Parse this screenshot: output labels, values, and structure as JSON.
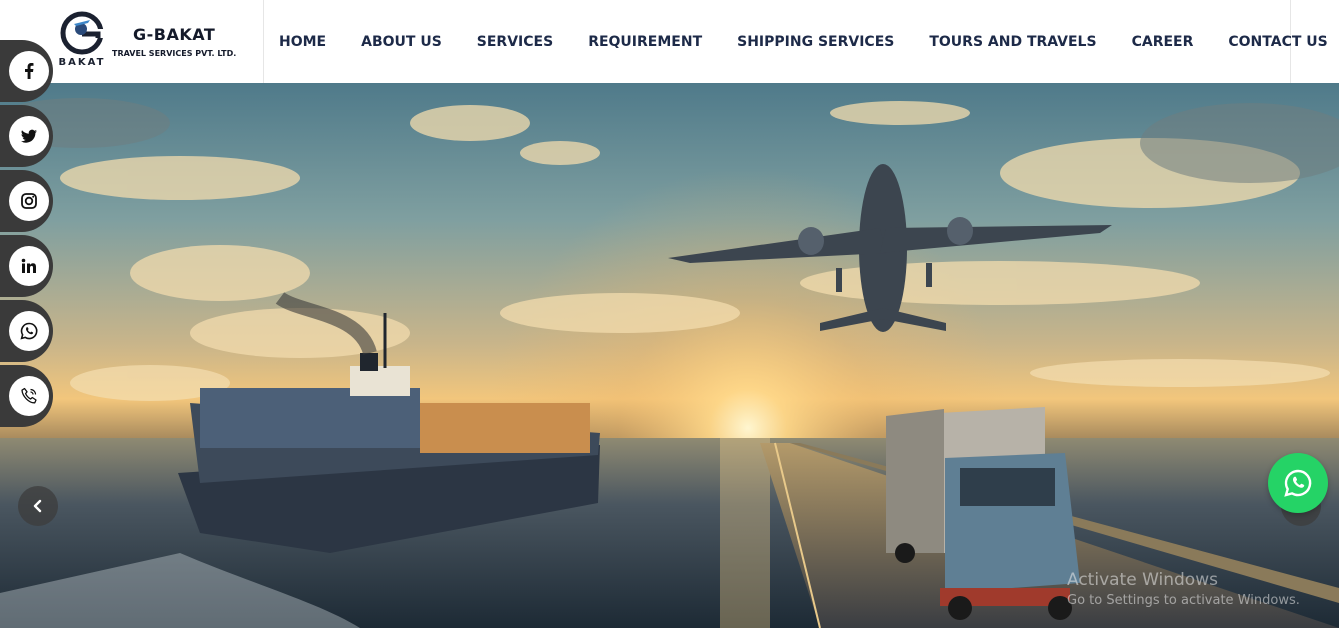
{
  "brand": {
    "logo_mark": "G",
    "logo_sub": "BAKAT",
    "name": "G-BAKAT",
    "tagline": "TRAVEL SERVICES PVT. LTD."
  },
  "nav": {
    "items": [
      {
        "label": "HOME"
      },
      {
        "label": "ABOUT US"
      },
      {
        "label": "SERVICES"
      },
      {
        "label": "REQUIREMENT"
      },
      {
        "label": "SHIPPING SERVICES"
      },
      {
        "label": "TOURS AND TRAVELS"
      },
      {
        "label": "CAREER"
      },
      {
        "label": "CONTACT US"
      }
    ]
  },
  "social": {
    "items": [
      {
        "icon": "facebook-icon"
      },
      {
        "icon": "twitter-icon"
      },
      {
        "icon": "instagram-icon"
      },
      {
        "icon": "linkedin-icon"
      },
      {
        "icon": "whatsapp-icon"
      },
      {
        "icon": "phone-icon"
      }
    ]
  },
  "slider": {
    "prev_icon": "chevron-left-icon",
    "next_icon": "chevron-right-icon"
  },
  "whatsapp_float": {
    "icon": "whatsapp-icon",
    "color": "#25d366"
  },
  "watermark": {
    "title": "Activate Windows",
    "subtitle": "Go to Settings to activate Windows."
  },
  "colors": {
    "nav_text": "#1d2a48",
    "brand_text": "#141a2a",
    "social_bg": "#3a3a3a"
  }
}
